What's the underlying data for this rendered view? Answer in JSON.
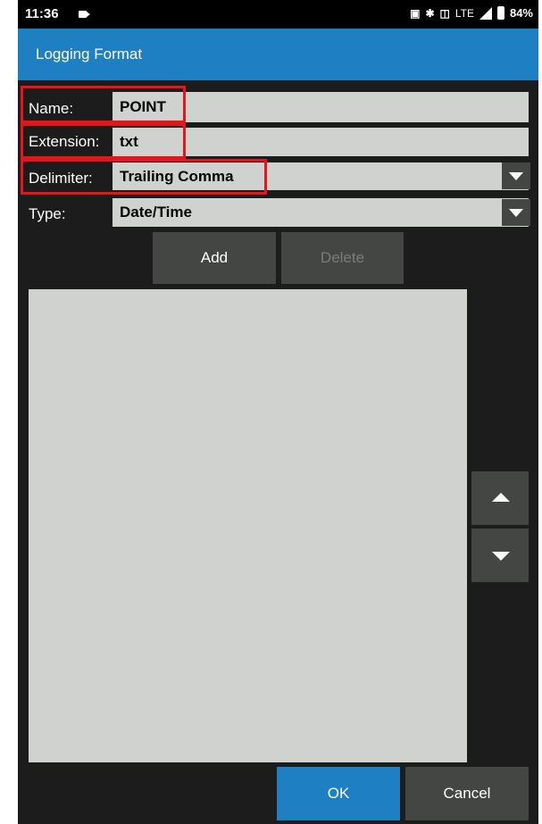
{
  "status_bar": {
    "time": "11:36",
    "network": "LTE",
    "battery": "84%"
  },
  "app_bar": {
    "title": "Logging Format"
  },
  "form": {
    "name_label": "Name:",
    "name_value": "POINT",
    "extension_label": "Extension:",
    "extension_value": "txt",
    "delimiter_label": "Delimiter:",
    "delimiter_value": "Trailing Comma",
    "type_label": "Type:",
    "type_value": "Date/Time"
  },
  "actions": {
    "add_label": "Add",
    "delete_label": "Delete",
    "ok_label": "OK",
    "cancel_label": "Cancel"
  },
  "colors": {
    "accent": "#1f7fc3",
    "background": "#1b1c1b",
    "field": "#d0d2cf",
    "button": "#444643",
    "highlight": "#e8141b"
  }
}
